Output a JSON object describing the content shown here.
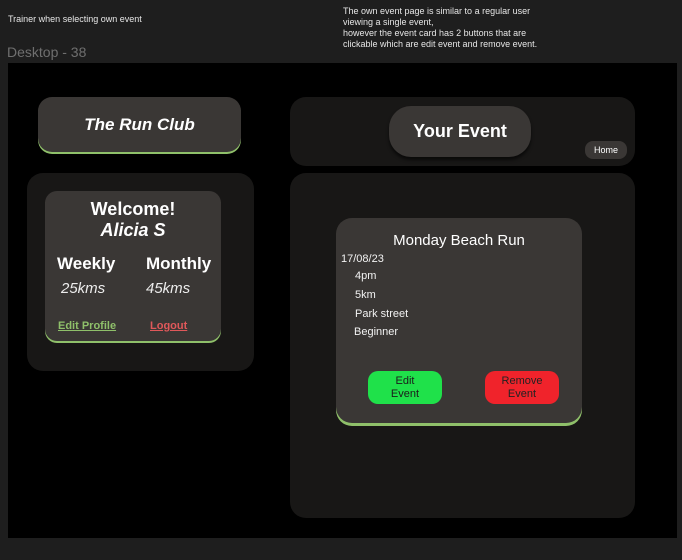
{
  "annotations": {
    "left_note": "Trainer when selecting own event",
    "right_note_lines": [
      "The own event page is similar to a regular user",
      "viewing a single event,",
      "however the event card has 2 buttons that are",
      "clickable which are edit event and remove event."
    ]
  },
  "frame_label": "Desktop - 38",
  "brand": {
    "title": "The Run Club"
  },
  "profile": {
    "greeting": "Welcome!",
    "name": "Alicia S",
    "weekly_label": "Weekly",
    "weekly_value": "25kms",
    "monthly_label": "Monthly",
    "monthly_value": "45kms",
    "edit_profile_label": "Edit Profile",
    "logout_label": "Logout"
  },
  "header": {
    "page_title": "Your Event",
    "home_label": "Home"
  },
  "event": {
    "title": "Monday Beach Run",
    "date": "17/08/23",
    "time": "4pm",
    "distance": "5km",
    "location": "Park street",
    "level": "Beginner",
    "edit_label_lines": [
      "Edit",
      "Event"
    ],
    "remove_label_lines": [
      "Remove",
      "Event"
    ]
  },
  "colors": {
    "accent_green": "#8fc06a",
    "logout_red": "#e0585a",
    "edit_button_green": "#1fe14a",
    "remove_button_red": "#f0232b",
    "card_bg": "#3a3735",
    "panel_bg": "#181716"
  }
}
